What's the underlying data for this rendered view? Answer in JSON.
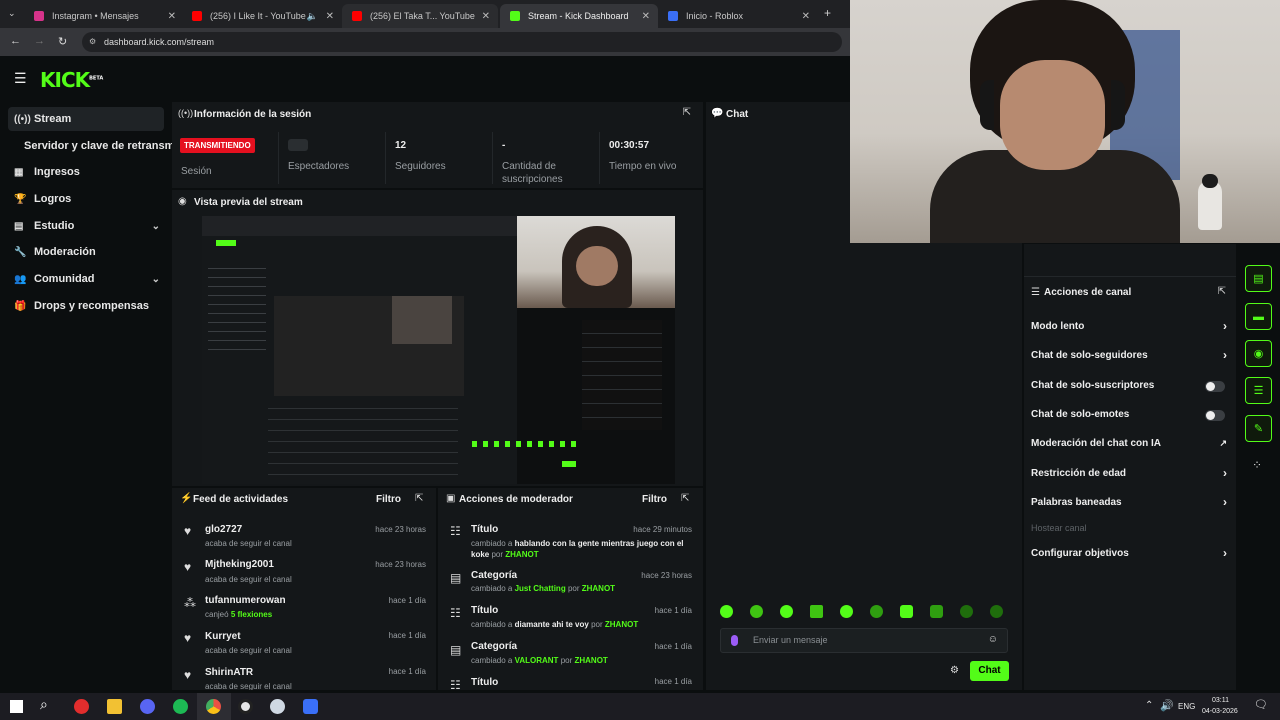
{
  "browser": {
    "tabs": [
      {
        "title": "Instagram • Mensajes",
        "color": "#d6338a"
      },
      {
        "title": "(256) I Like It - YouTube",
        "color": "#ff0000"
      },
      {
        "title": "(256) El Taka T... YouTube",
        "color": "#ff0000"
      },
      {
        "title": "Stream - Kick Dashboard",
        "color": "#53fc18"
      },
      {
        "title": "Inicio - Roblox",
        "color": "#3a6ff7"
      }
    ],
    "url": "dashboard.kick.com/stream"
  },
  "kick": {
    "logo": "KICK",
    "logo_badge": "BETA",
    "accent": "#53fc18"
  },
  "sidebar": {
    "items": [
      {
        "label": "Stream",
        "icon": "broadcast-icon"
      },
      {
        "label": "Servidor y clave de retransmisión",
        "icon": ""
      },
      {
        "label": "Ingresos",
        "icon": "chart-icon"
      },
      {
        "label": "Logros",
        "icon": "trophy-icon"
      },
      {
        "label": "Estudio",
        "icon": "grid-icon"
      },
      {
        "label": "Moderación",
        "icon": "wrench-icon"
      },
      {
        "label": "Comunidad",
        "icon": "people-icon"
      },
      {
        "label": "Drops y recompensas",
        "icon": "gift-icon"
      }
    ]
  },
  "session": {
    "title": "Información de la sesión",
    "live_badge": "TRANSMITIENDO",
    "live_label": "Sesión",
    "viewers_label": "Espectadores",
    "followers_value": "12",
    "followers_label": "Seguidores",
    "subs_value": "-",
    "subs_label_1": "Cantidad de",
    "subs_label_2": "suscripciones",
    "uptime_value": "00:30:57",
    "uptime_label": "Tiempo en vivo"
  },
  "preview": {
    "title": "Vista previa del stream"
  },
  "activity": {
    "title": "Feed de actividades",
    "filter": "Filtro",
    "items": [
      {
        "name": "glo2727",
        "sub": "acaba de seguir el canal",
        "time": "hace 23 horas",
        "icon": "heart-icon"
      },
      {
        "name": "Mjtheking2001",
        "sub": "acaba de seguir el canal",
        "time": "hace 23 horas",
        "icon": "heart-icon"
      },
      {
        "name": "tufannumerowan",
        "sub_prefix": "canjeó",
        "sub_highlight": "5 flexiones",
        "time": "hace 1 día",
        "icon": "reward-icon"
      },
      {
        "name": "Kurryet",
        "sub": "acaba de seguir el canal",
        "time": "hace 1 día",
        "icon": "heart-icon"
      },
      {
        "name": "ShirinATR",
        "sub": "acaba de seguir el canal",
        "time": "hace 1 día",
        "icon": "heart-icon"
      }
    ]
  },
  "modactions": {
    "title": "Acciones de moderador",
    "filter": "Filtro",
    "items": [
      {
        "type": "Título",
        "prefix": "cambiado a",
        "value": "hablando con la gente mientras juego con el koke",
        "by": "por",
        "user": "ZHANOT",
        "time": "hace 29 minutos"
      },
      {
        "type": "Categoría",
        "prefix": "cambiado a",
        "value": "Just Chatting",
        "by": "por",
        "user": "ZHANOT",
        "time": "hace 23 horas"
      },
      {
        "type": "Título",
        "prefix": "cambiado a",
        "value": "diamante ahi te voy",
        "by": "por",
        "user": "ZHANOT",
        "time": "hace 1 día"
      },
      {
        "type": "Categoría",
        "prefix": "cambiado a",
        "value": "VALORANT",
        "by": "por",
        "user": "ZHANOT",
        "time": "hace 1 día"
      },
      {
        "type": "Título",
        "time": "hace 1 día"
      }
    ]
  },
  "chat": {
    "title": "Chat",
    "placeholder": "Enviar un mensaje",
    "send": "Chat"
  },
  "channel_actions": {
    "title": "Acciones de canal",
    "items": [
      {
        "label": "Modo lento",
        "control": "arrow"
      },
      {
        "label": "Chat de solo-seguidores",
        "control": "arrow"
      },
      {
        "label": "Chat de solo-suscriptores",
        "control": "toggle"
      },
      {
        "label": "Chat de solo-emotes",
        "control": "toggle"
      },
      {
        "label": "Moderación del chat con IA",
        "control": "external"
      },
      {
        "label": "Restricción de edad",
        "control": "arrow"
      },
      {
        "label": "Palabras baneadas",
        "control": "arrow"
      },
      {
        "label": "Hostear canal",
        "control": "none",
        "disabled": true
      },
      {
        "label": "Configurar objetivos",
        "control": "arrow"
      }
    ]
  },
  "taskbar": {
    "lang": "ENG",
    "time": "03:11",
    "date": "04-03-2026"
  }
}
